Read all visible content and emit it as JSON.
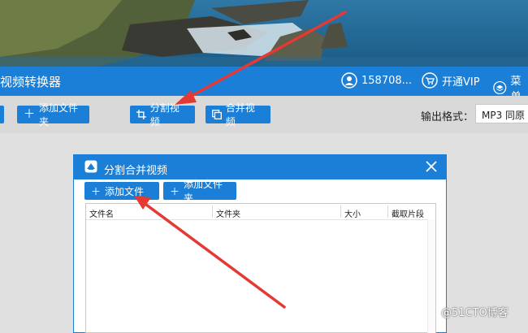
{
  "window": {
    "title": "视频转换器",
    "account": "158708...",
    "vip_label": "开通VIP",
    "menu_label": "菜单"
  },
  "toolbar": {
    "add_folder_label": "添加文件夹",
    "split_video_label": "分割视频",
    "merge_video_label": "合并视频",
    "output_format_label": "输出格式：",
    "output_format_value": "MP3  同原"
  },
  "dialog": {
    "title": "分割合并视频",
    "add_file_label": "添加文件",
    "add_folder_label": "添加文件夹",
    "columns": [
      "文件名",
      "文件夹",
      "大小",
      "截取片段"
    ]
  },
  "watermark": "@51CTO博客",
  "colors": {
    "accent": "#1c7fd7",
    "arrow": "#e53935"
  }
}
